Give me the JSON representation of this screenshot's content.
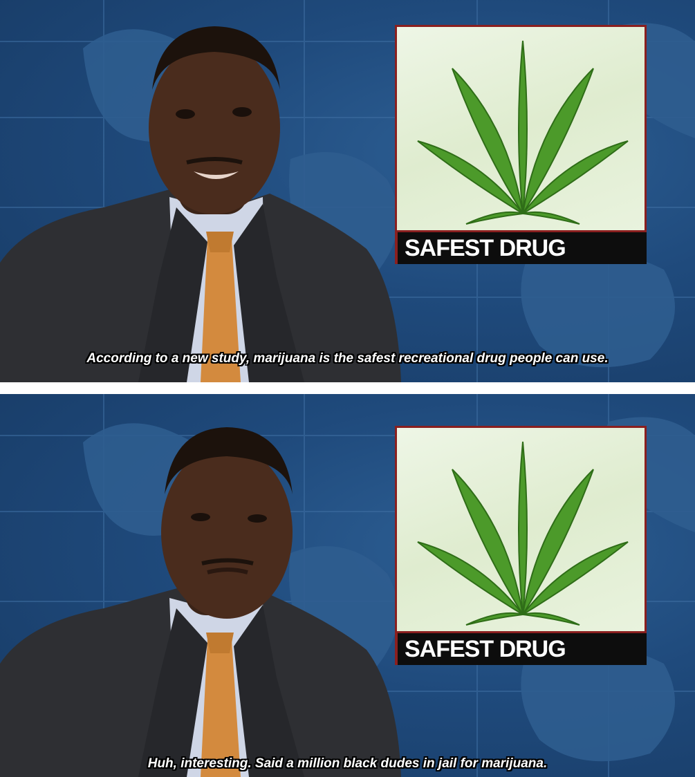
{
  "panels": [
    {
      "graphic_label": "SAFEST DRUG",
      "caption": "According to a new study, marijuana is the safest recreational drug people can use."
    },
    {
      "graphic_label": "SAFEST DRUG",
      "caption": "Huh, interesting. Said a million black dudes in jail for marijuana."
    }
  ],
  "colors": {
    "background_blue": "#1f4a7c",
    "label_bar": "#0d0d0d",
    "label_border": "#8a1f1f",
    "leaf_green": "#4c9a2a",
    "suit": "#2e2f33",
    "tie": "#d38a3e",
    "shirt": "#cfd6e6"
  },
  "icons": [
    "cannabis-leaf-icon"
  ]
}
